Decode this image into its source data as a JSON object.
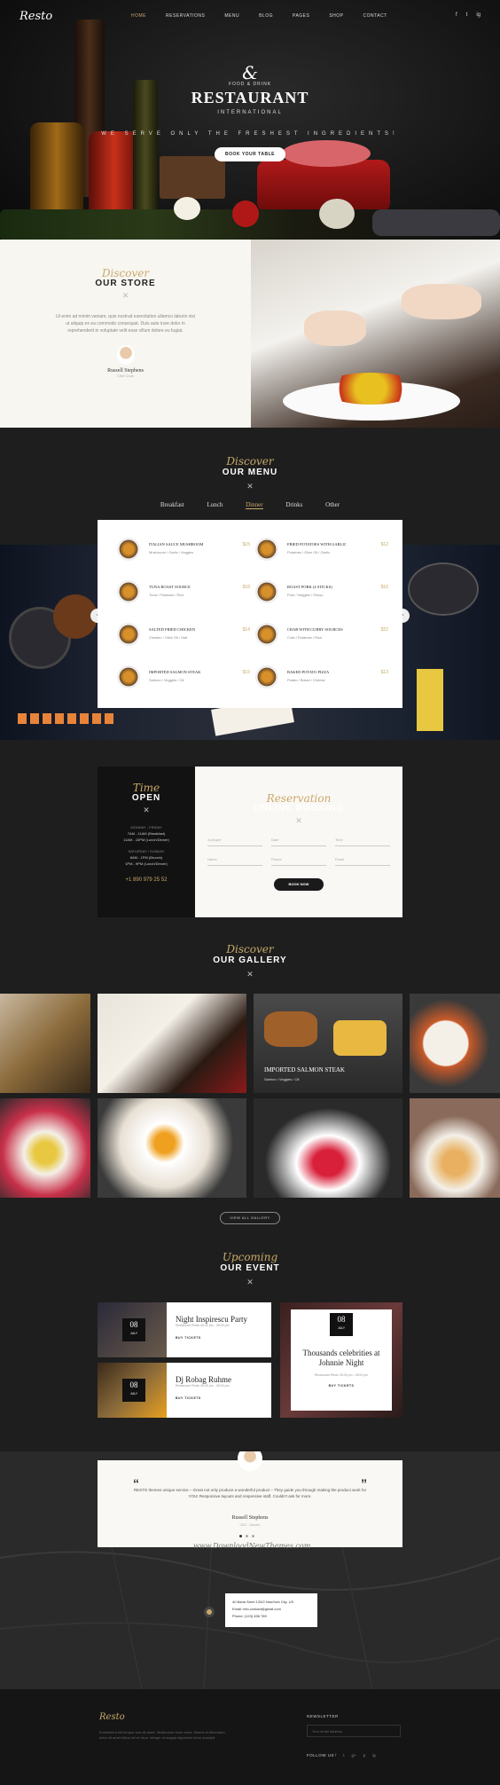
{
  "nav": {
    "logo": "Resto",
    "items": [
      "HOME",
      "RESERVATIONS",
      "MENU",
      "BLOG",
      "PAGES",
      "SHOP",
      "CONTACT"
    ],
    "active": "HOME",
    "social": [
      "f",
      "t",
      "ig"
    ]
  },
  "hero": {
    "ampersand": "&",
    "food_drink": "FOOD & DRINK",
    "title": "RESTAURANT",
    "subtitle": "INTERNATIONAL",
    "tagline": "WE SERVE ONLY THE FRESHEST INGREDIENTS!",
    "button": "BOOK YOUR TABLE"
  },
  "store": {
    "script": "Discover",
    "title": "OUR STORE",
    "text": "Ut enim ad minim veniam, quis nostrud exercitation ullamco laboris nisi ut aliquip ex ea commodo consequat. Duis aute irure dolor in reprehenderit in voluptate velit esse cillum dolore eu fugiat.",
    "name": "Russell Stephens",
    "role": "Chef Cook"
  },
  "menu": {
    "script": "Discover",
    "title": "OUR MENU",
    "tabs": [
      "Breakfast",
      "Lunch",
      "Dinner",
      "Drinks",
      "Other"
    ],
    "active_tab": "Dinner",
    "items": [
      {
        "name": "ITALIAN SAUCE MUSHROOM",
        "ing": "Mushroom / Garlic / Veggies",
        "price": "$15"
      },
      {
        "name": "FRIED POTATOES WITH GARLIC",
        "ing": "Potatoes / Olive Oil / Garlic",
        "price": "$12"
      },
      {
        "name": "TUNA ROAST SOURCE",
        "ing": "Tuna / Potatoes / Rice",
        "price": "$18"
      },
      {
        "name": "ROAST PORK (4 STICKS)",
        "ing": "Pork / Veggies / Shoyu",
        "price": "$16"
      },
      {
        "name": "SALTED FRIED CHICKEN",
        "ing": "Chicken / Olive Oil / Salt",
        "price": "$14"
      },
      {
        "name": "CRAB WITH CURRY SOURCES",
        "ing": "Crab / Potatoes / Rice",
        "price": "$22"
      },
      {
        "name": "IMPORTED SALMON STEAK",
        "ing": "Salmon / Veggies / Oil",
        "price": "$15"
      },
      {
        "name": "BAKED POTATO PIZZA",
        "ing": "Potato / Bread / Cheese",
        "price": "$13"
      }
    ],
    "prev": "‹",
    "next": "›"
  },
  "booking": {
    "time_script": "Time",
    "time_title": "OPEN",
    "weekday_label": "MONDAY - FRIDAY",
    "weekday_1": "7AM - 11AM (Breakfast)",
    "weekday_2": "11AM - 10PM (Lunch/Dinner)",
    "weekend_label": "SATURDAY / SUNDAY",
    "weekend_1": "8AM - 1PM (Brunch)",
    "weekend_2": "1PM - 9PM (Lunch/Dinner)",
    "phone": "+1 890 979 25 52",
    "script": "Reservation",
    "title": "ONLINE BOOKING",
    "fields": [
      "4 people",
      "Date",
      "Time",
      "Name",
      "Phone",
      "Email"
    ],
    "button": "BOOK NOW"
  },
  "gallery": {
    "script": "Discover",
    "title": "OUR GALLERY",
    "caption_title": "IMPORTED SALMON STEAK",
    "caption_ing": "Salmon / Veggies / Oil",
    "button": "VIEW ALL GALLERY"
  },
  "events": {
    "script": "Upcoming",
    "title": "OUR EVENT",
    "items": [
      {
        "day": "08",
        "month": "JULY",
        "title": "Night Inspirescu Party",
        "meta": "Restaurant Resto   05:00 pm - 08:00 pm",
        "btn": "BUY TICKETS"
      },
      {
        "day": "08",
        "month": "JULY",
        "title": "Dj Robag Ruhme",
        "meta": "Restaurant Resto   05:00 pm - 08:00 pm",
        "btn": "BUY TICKETS"
      },
      {
        "day": "08",
        "month": "JULY",
        "title": "Thousands celebrities at Johnnie Night",
        "meta": "Restaurant Resto   05:00 pm - 08:00 pm",
        "btn": "BUY TICKETS"
      }
    ]
  },
  "testimonial": {
    "open_quote": "“",
    "close_quote": "”",
    "text": "RESTO themes unique service – Great not only produce a wonderful product – They guide you through making the product work for YOU! Responsive layouts and responsive staff. Couldn't ask for more.",
    "name": "Russell Stephens",
    "role": "CEO - Director"
  },
  "watermark": "www.DownloadNewThemes.com",
  "map": {
    "address": "40 Baria Sreet 133/2 NewYork City, US",
    "email": "Email: info.contact@gmail.com",
    "phone": "Phone: (123) 456 789"
  },
  "footer": {
    "logo": "Resto",
    "text": "Excitement elit tempor sed dit amet. Vestibulum dolor amet. Mauris et bibendum dolor sit amet tellus vel et risus. Integer at magna dignissim tortor suscipit.",
    "newsletter": "NEWSLETTER",
    "email_placeholder": "Your email address",
    "follow": "FOLLOW US",
    "social": [
      "f",
      "t",
      "g+",
      "p",
      "ig"
    ]
  },
  "colors": {
    "accent": "#c9a96a",
    "dark": "#1e1e1e",
    "light": "#faf8f4"
  }
}
